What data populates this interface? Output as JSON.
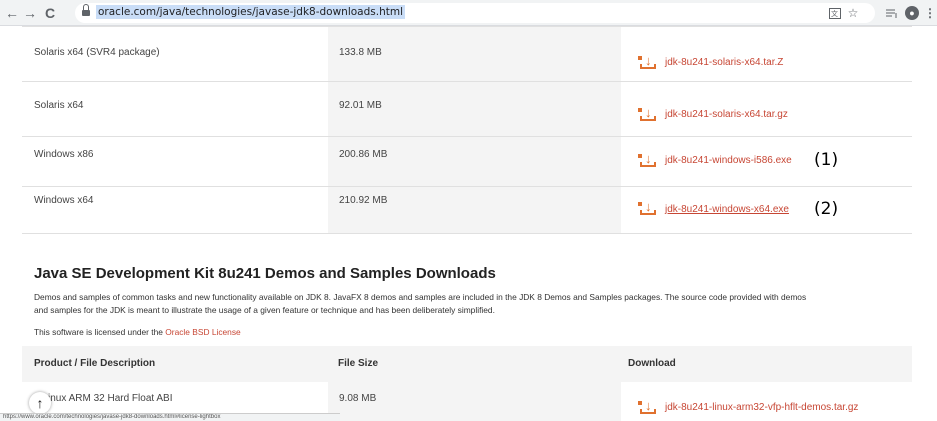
{
  "browser": {
    "url": "oracle.com/java/technologies/javase-jdk8-downloads.html",
    "nav": {
      "back": "←",
      "forward": "→",
      "reload": "C"
    },
    "right_icons": [
      "translate-icon",
      "star-icon",
      "reading-list-icon",
      "profile-icon",
      "more-icon"
    ]
  },
  "rows": [
    {
      "product": "Solaris x64 (SVR4 package)",
      "size": "133.8 MB",
      "file": "jdk-8u241-solaris-x64.tar.Z",
      "annotation": ""
    },
    {
      "product": "Solaris x64",
      "size": "92.01 MB",
      "file": "jdk-8u241-solaris-x64.tar.gz",
      "annotation": ""
    },
    {
      "product": "Windows x86",
      "size": "200.86 MB",
      "file": "jdk-8u241-windows-i586.exe",
      "annotation": "(1)"
    },
    {
      "product": "Windows x64",
      "size": "210.92 MB",
      "file": "jdk-8u241-windows-x64.exe",
      "annotation": "(2)"
    }
  ],
  "demos": {
    "title": "Java SE Development Kit 8u241 Demos and Samples Downloads",
    "para1": "Demos and samples of common tasks and new functionality available on JDK 8. JavaFX 8 demos and samples are included in the JDK 8 Demos and Samples packages. The source code provided with demos",
    "para2": "and samples for the JDK is meant to illustrate the usage of a given feature or technique and has been deliberately simplified.",
    "license_prefix": "This software is licensed under the ",
    "license_link": "Oracle BSD License",
    "headers": {
      "product": "Product / File Description",
      "size": "File Size",
      "download": "Download"
    },
    "row": {
      "product": "inux ARM 32 Hard Float ABI",
      "size": "9.08 MB",
      "file": "jdk-8u241-linux-arm32-vfp-hflt-demos.tar.gz"
    }
  },
  "status_url": "https://www.oracle.com/technologies/javase-jdk8-downloads.html#license-lightbox",
  "colors": {
    "accent": "#c74634",
    "download_icon": "#e0712f",
    "cell_gray": "#f4f4f4"
  }
}
